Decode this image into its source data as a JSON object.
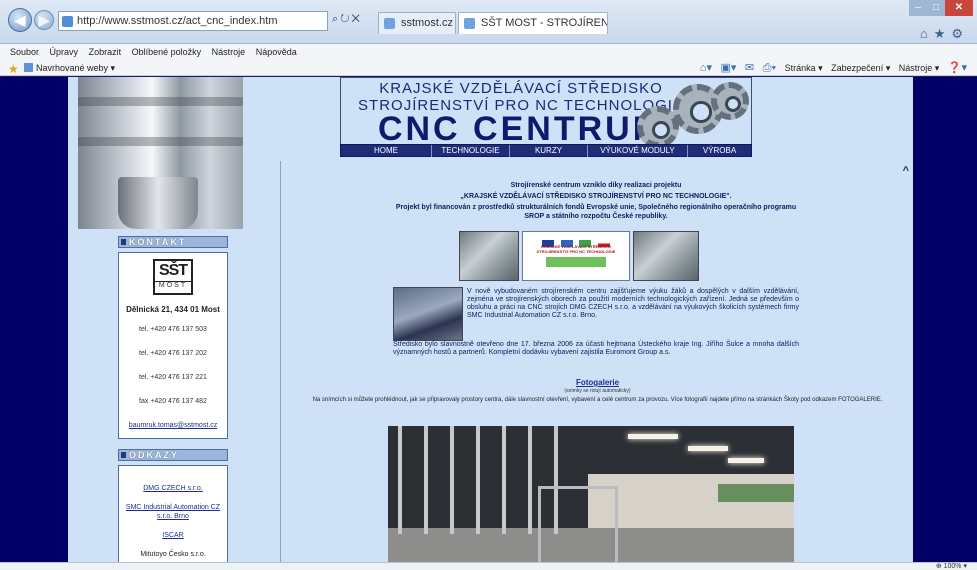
{
  "browser": {
    "url": "http://www.sstmost.cz/act_cnc_index.htm",
    "tabs": [
      {
        "label": "sstmost.cz"
      },
      {
        "label": "SŠT MOST - STROJÍRENSKÉ ...",
        "close": "×"
      }
    ],
    "menu": [
      "Soubor",
      "Úpravy",
      "Zobrazit",
      "Oblíbené položky",
      "Nástroje",
      "Nápověda"
    ],
    "favorites": {
      "suggested": "Navrhované weby ▾"
    },
    "commands": {
      "page": "Stránka ▾",
      "safety": "Zabezpečení ▾",
      "tools": "Nástroje ▾"
    },
    "zoom": "100%"
  },
  "banner": {
    "line1": "KRAJSKÉ VZDĚLÁVACÍ STŘEDISKO",
    "line2": "STROJÍRENSTVÍ PRO NC TECHNOLOGIE",
    "line3": "CNC CENTRUM"
  },
  "nav": [
    "HOME",
    "TECHNOLOGIE",
    "KURZY",
    "VÝUKOVÉ MODULY",
    "VÝROBA"
  ],
  "sidebar": {
    "kontakt_title": "KONTAKT",
    "logo_big": "SŠT",
    "logo_small": "MOST",
    "address": "Dělnická 21, 434 01 Most",
    "phones": [
      "tel. +420 476 137 503",
      "tel. +420 476 137 202",
      "tel. +420 476 137 221",
      "fax +420 476 137 482"
    ],
    "email": "baumruk.tomas@sstmost.cz",
    "odkazy_title": "ODKAZY",
    "links": [
      "DMG CZECH s.r.o.",
      "SMC Industrial Automation CZ s.r.o. Brno",
      "ISCAR",
      "Mitutoyo Česko s.r.o."
    ]
  },
  "content": {
    "intro1": "Strojírenské centrum vzniklo díky realizaci projektu",
    "intro2": "„KRAJSKÉ VZDĚLÁVACÍ STŘEDISKO STROJÍRENSTVÍ PRO NC TECHNOLOGIE\".",
    "intro3": "Projekt byl financován z prostředků strukturálních fondů Evropské unie, Společného regionálního operačního programu SROP a státního rozpočtu České republiky.",
    "sign_text": "KRAJSKÉ VZDĚLÁVACÍ STŘEDISKO STROJÍRENSTVÍ PRO NC TECHNOLOGIE",
    "para1": "V nově vybudovaném strojírenském centru zajišťujeme výuku žáků a dospělých v dalším vzdělávání, zejména ve strojírenských oborech za použití moderních technologických zařízení. Jedná se především o obsluhu a práci na CNC strojích DMG CZECH s.r.o. a vzdělávání na výukových školicích systémech firmy SMC Industrial Automation CZ s.r.o. Brno.",
    "para2": "Středisko bylo slavnostně otevřeno dne 17. března 2006 za účasti hejtmana Ústeckého kraje Ing. Jiřího Šulce a mnoha dalších významných hostů a partnerů. Kompletní dodávku vybavení zajistila Euromont Group a.s.",
    "gallery_title": "Fotogalerie",
    "gallery_note": "(snímky se rolují automaticky)",
    "gallery_text": "Na snímcích si můžete prohlédnout, jak se připravovaly prostory centra, dále slavnostní otevření, vybavení a celé centrum za provozu. Více fotografií najdete přímo na stránkách Škoty pod odkazem FOTOGALERIE."
  }
}
